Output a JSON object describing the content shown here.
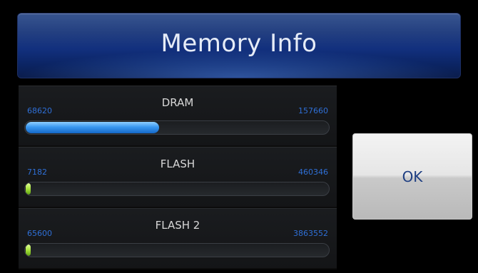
{
  "header": {
    "title": "Memory Info"
  },
  "memory": [
    {
      "name": "DRAM",
      "min": "68620",
      "max": "157660",
      "fill_fraction": 0.44,
      "bar_color": "#3a98f0"
    },
    {
      "name": "FLASH",
      "min": "7182",
      "max": "460346",
      "fill_fraction": 0.016,
      "bar_color": "#a6e23a"
    },
    {
      "name": "FLASH 2",
      "min": "65600",
      "max": "3863552",
      "fill_fraction": 0.017,
      "bar_color": "#a6e23a"
    }
  ],
  "dialog": {
    "ok_label": "OK"
  },
  "colors": {
    "accent": "#12307e",
    "value_text": "#2f6fd6",
    "ok_text": "#1e3e82"
  }
}
